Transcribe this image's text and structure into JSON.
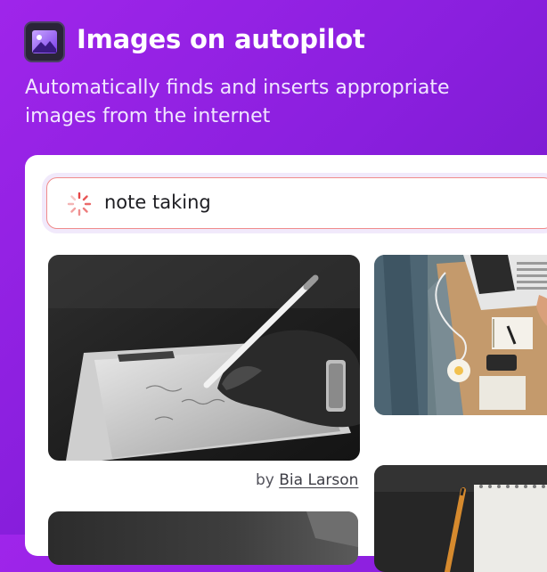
{
  "header": {
    "icon": "image-icon",
    "title": "Images on autopilot",
    "subtitle": "Automatically finds and inserts appropriate images from the internet"
  },
  "search": {
    "icon": "loading-spinner-icon",
    "query": "note taking",
    "accent_color": "#e64545"
  },
  "results": [
    {
      "subject": "black-and-white photo of a hand writing on a tablet with a stylus",
      "credit_prefix": "by",
      "author": "Bia Larson"
    },
    {
      "subject": "top view of a desk with a laptop, notebook, phone and candle"
    },
    {
      "subject": "notebook and pencil on a dark surface"
    },
    {
      "subject": "photo (cropped)"
    }
  ],
  "colors": {
    "background_start": "#9f25ea",
    "background_end": "#6e18c4",
    "card": "#ffffff"
  }
}
